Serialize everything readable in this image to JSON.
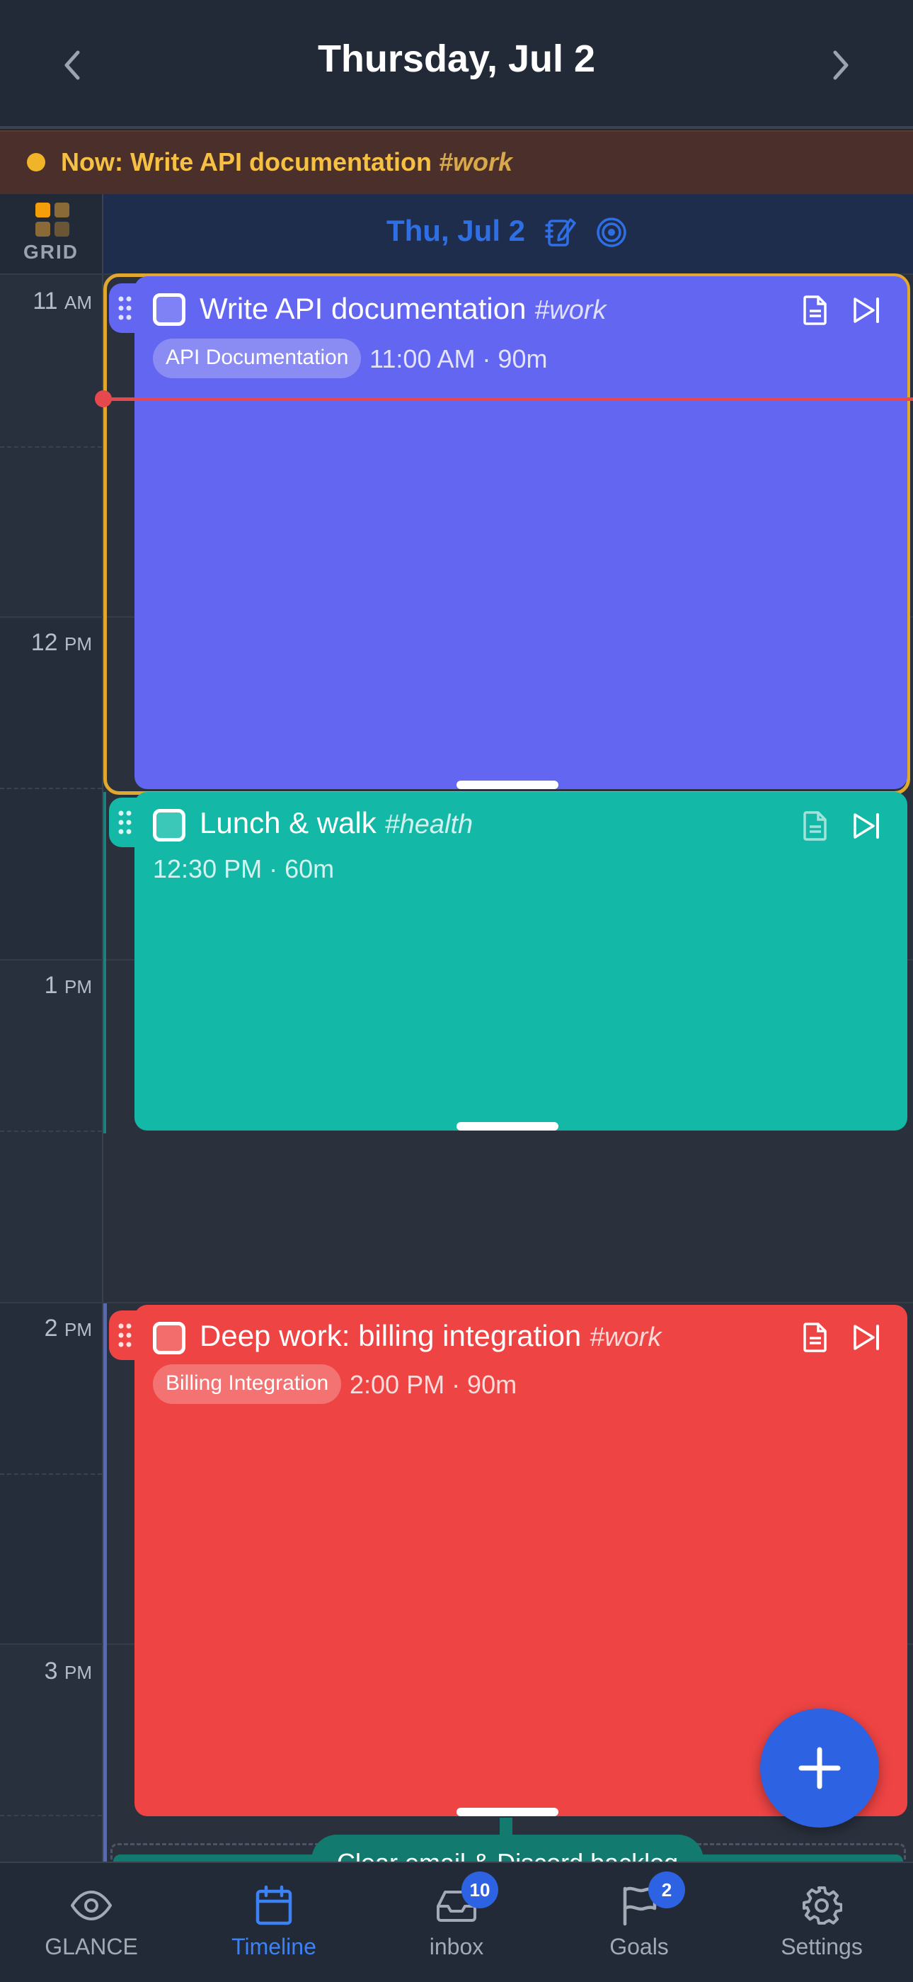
{
  "header": {
    "title": "Thursday, Jul 2"
  },
  "now_bar": {
    "prefix": "Now: Write API documentation",
    "tag": "#work"
  },
  "grid_label": "GRID",
  "day": {
    "label": "Thu, Jul 2"
  },
  "hours": [
    {
      "num": "11",
      "ap": "AM"
    },
    {
      "num": "12",
      "ap": "PM"
    },
    {
      "num": "1",
      "ap": "PM"
    },
    {
      "num": "2",
      "ap": "PM"
    },
    {
      "num": "3",
      "ap": "PM"
    }
  ],
  "events": [
    {
      "title": "Write API documentation",
      "tag": "#work",
      "project": "API Documentation",
      "meta": "11:00 AM · 90m",
      "color": "#6366f1"
    },
    {
      "title": "Lunch & walk",
      "tag": "#health",
      "project": "",
      "meta": "12:30 PM · 60m",
      "color": "#14b8a6"
    },
    {
      "title": "Deep work: billing integration",
      "tag": "#work",
      "project": "Billing Integration",
      "meta": "2:00 PM · 90m",
      "color": "#ef4444"
    }
  ],
  "next_task": {
    "label": "Clear email & Discord backlog"
  },
  "bottom_nav": [
    {
      "label": "GLANCE",
      "icon": "eye-icon",
      "badge": ""
    },
    {
      "label": "Timeline",
      "icon": "calendar-icon",
      "badge": ""
    },
    {
      "label": "inbox",
      "icon": "inbox-icon",
      "badge": "10"
    },
    {
      "label": "Goals",
      "icon": "flag-icon",
      "badge": "2"
    },
    {
      "label": "Settings",
      "icon": "gear-icon",
      "badge": ""
    }
  ],
  "colors": {
    "accent": "#2d63e2",
    "now": "#f6c143",
    "current_time_line": "#e5484d",
    "active_outline": "#e0a82e"
  }
}
